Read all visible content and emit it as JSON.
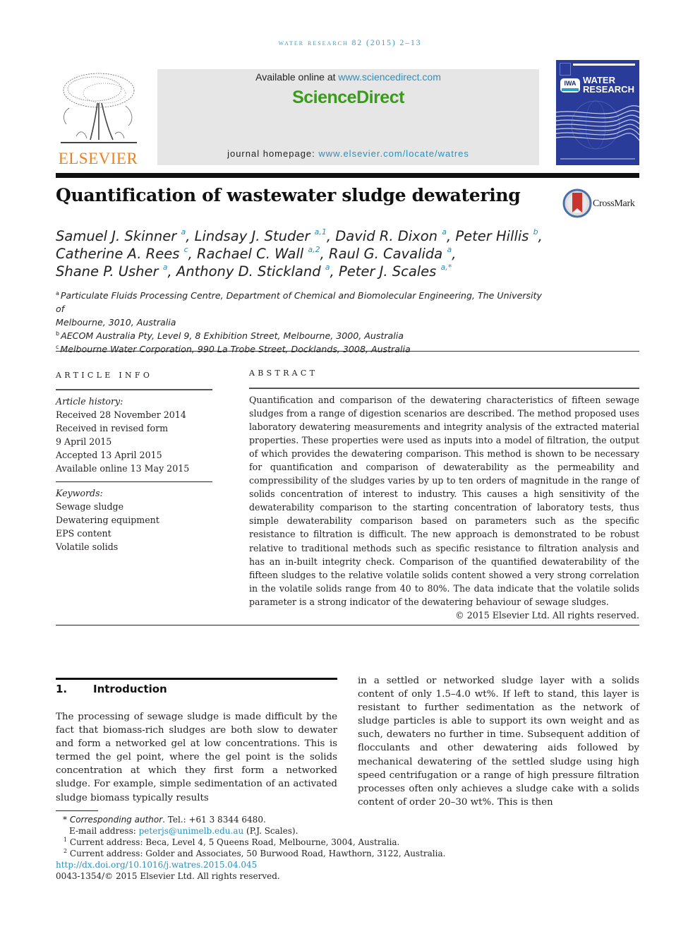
{
  "running_head": "water research 82 (2015) 2–13",
  "publisher_logo": {
    "name": "ELSEVIER",
    "color": "#f07f1b"
  },
  "sciencedirect_box": {
    "available_prefix": "Available online at ",
    "available_link": "www.sciencedirect.com",
    "brand": "ScienceDirect",
    "brand_color": "#3a9b1b",
    "homepage_prefix": "journal homepage: ",
    "homepage_link": "www.elsevier.com/locate/watres"
  },
  "journal_cover": {
    "line1": "WATER",
    "line2": "RESEARCH",
    "badge": "IWA",
    "bg_color": "#2a3c99"
  },
  "article": {
    "title": "Quantification of wastewater sludge dewatering",
    "crossmark_label": "CrossMark",
    "authors": [
      {
        "name": "Samuel J. Skinner",
        "sup": "a",
        "sep": ", "
      },
      {
        "name": "Lindsay J. Studer",
        "sup": "a,1",
        "sep": ", "
      },
      {
        "name": "David R. Dixon",
        "sup": "a",
        "sep": ", "
      },
      {
        "name": "Peter Hillis",
        "sup": "b",
        "sep": ","
      },
      {
        "name": "Catherine A. Rees",
        "sup": "c",
        "sep": ", "
      },
      {
        "name": "Rachael C. Wall",
        "sup": "a,2",
        "sep": ", "
      },
      {
        "name": "Raul G. Cavalida",
        "sup": "a",
        "sep": ","
      },
      {
        "name": "Shane P. Usher",
        "sup": "a",
        "sep": ", "
      },
      {
        "name": "Anthony D. Stickland",
        "sup": "a",
        "sep": ", "
      },
      {
        "name": "Peter J. Scales",
        "sup": "a,*",
        "sep": ""
      }
    ],
    "affiliations": [
      {
        "key": "a",
        "text_line1": "Particulate Fluids Processing Centre, Department of Chemical and Biomolecular Engineering, The University of",
        "text_line2": "Melbourne, 3010, Australia"
      },
      {
        "key": "b",
        "text_line1": "AECOM Australia Pty, Level 9, 8 Exhibition Street, Melbourne, 3000, Australia"
      },
      {
        "key": "c",
        "text_line1": "Melbourne Water Corporation, 990 La Trobe Street, Docklands, 3008, Australia"
      }
    ]
  },
  "article_info": {
    "heading": "ARTICLE INFO",
    "history_label": "Article history:",
    "history": [
      "Received 28 November 2014",
      "Received in revised form",
      "9 April 2015",
      "Accepted 13 April 2015",
      "Available online 13 May 2015"
    ],
    "keywords_label": "Keywords:",
    "keywords": [
      "Sewage sludge",
      "Dewatering equipment",
      "EPS content",
      "Volatile solids"
    ]
  },
  "abstract": {
    "heading": "ABSTRACT",
    "text": "Quantification and comparison of the dewatering characteristics of fifteen sewage sludges from a range of digestion scenarios are described. The method proposed uses laboratory dewatering measurements and integrity analysis of the extracted material properties. These properties were used as inputs into a model of filtration, the output of which provides the dewatering comparison. This method is shown to be necessary for quantification and comparison of dewaterability as the permeability and compressibility of the sludges varies by up to ten orders of magnitude in the range of solids concentration of interest to industry. This causes a high sensitivity of the dewaterability comparison to the starting concentration of laboratory tests, thus simple dewaterability comparison based on parameters such as the specific resistance to filtration is difficult. The new approach is demonstrated to be robust relative to traditional methods such as specific resistance to filtration analysis and has an in-built integrity check. Comparison of the quantified dewaterability of the fifteen sludges to the relative volatile solids content showed a very strong correlation in the volatile solids range from 40 to 80%. The data indicate that the volatile solids parameter is a strong indicator of the dewatering behaviour of sewage sludges.",
    "copyright": "© 2015 Elsevier Ltd. All rights reserved."
  },
  "introduction": {
    "number": "1.",
    "title": "Introduction",
    "col1": "The processing of sewage sludge is made difficult by the fact that biomass-rich sludges are both slow to dewater and form a networked gel at low concentrations. This is termed the gel point, where the gel point is the solids concentration at which they first form a networked sludge. For example, simple sedimentation of an activated sludge biomass typically results",
    "col2": "in a settled or networked sludge layer with a solids content of only 1.5–4.0 wt%. If left to stand, this layer is resistant to further sedimentation as the network of sludge particles is able to support its own weight and as such, dewaters no further in time. Subsequent addition of flocculants and other dewatering aids followed by mechanical dewatering of the settled sludge using high speed centrifugation or a range of high pressure filtration processes often only achieves a sludge cake with a solids content of order 20–30 wt%. This is then"
  },
  "footnotes": {
    "corr_mark": "*",
    "corr_label": "Corresponding author",
    "corr_tel": ". Tel.: +61 3 8344 6480.",
    "email_label": "E-mail address: ",
    "email": "peterjs@unimelb.edu.au",
    "email_suffix": " (P.J. Scales).",
    "note1_mark": "1",
    "note1": "Current address: Beca, Level 4, 5 Queens Road, Melbourne, 3004, Australia.",
    "note2_mark": "2",
    "note2": "Current address: Golder and Associates, 50 Burwood Road, Hawthorn, 3122, Australia.",
    "doi": "http://dx.doi.org/10.1016/j.watres.2015.04.045",
    "issn": "0043-1354/© 2015 Elsevier Ltd. All rights reserved."
  }
}
